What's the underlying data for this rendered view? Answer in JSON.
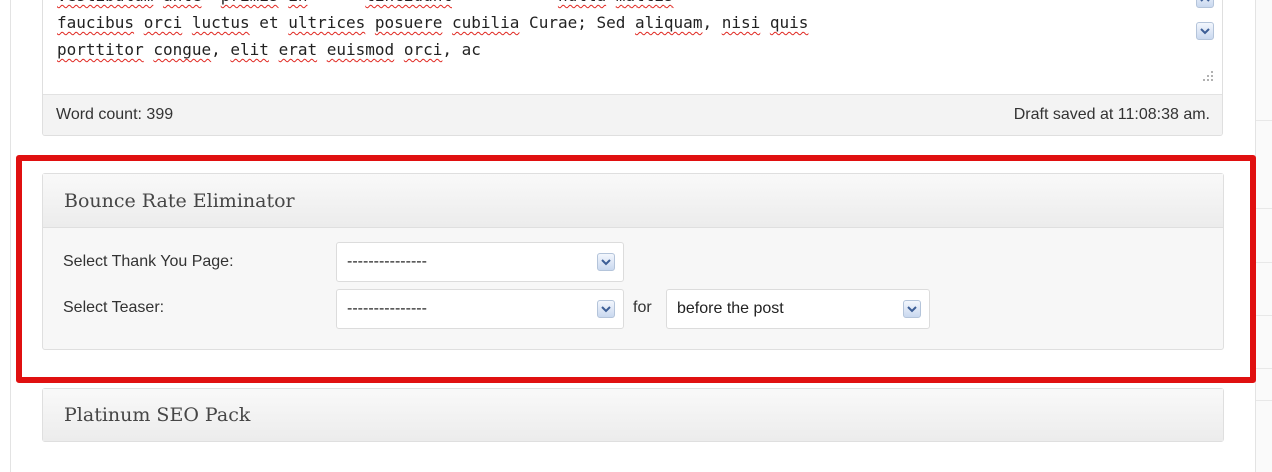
{
  "editor": {
    "lines": [
      [
        {
          "t": "faucibus",
          "s": true
        },
        {
          "t": " ",
          "s": false
        },
        {
          "t": "orci",
          "s": true
        },
        {
          "t": " ",
          "s": false
        },
        {
          "t": "luctus",
          "s": true
        },
        {
          "t": " et ",
          "s": false
        },
        {
          "t": "ultrices",
          "s": true
        },
        {
          "t": " ",
          "s": false
        },
        {
          "t": "posuere",
          "s": true
        },
        {
          "t": " ",
          "s": false
        },
        {
          "t": "cubilia",
          "s": true
        },
        {
          "t": " Curae; Sed ",
          "s": false
        },
        {
          "t": "aliquam",
          "s": true
        },
        {
          "t": ", ",
          "s": false
        },
        {
          "t": "nisi",
          "s": true
        },
        {
          "t": " ",
          "s": false
        },
        {
          "t": "quis",
          "s": true
        }
      ],
      [
        {
          "t": "porttitor",
          "s": true
        },
        {
          "t": " ",
          "s": false
        },
        {
          "t": "congue",
          "s": true
        },
        {
          "t": ", ",
          "s": false
        },
        {
          "t": "elit",
          "s": true
        },
        {
          "t": " ",
          "s": false
        },
        {
          "t": "erat",
          "s": true
        },
        {
          "t": " ",
          "s": false
        },
        {
          "t": "euismod",
          "s": true
        },
        {
          "t": " ",
          "s": false
        },
        {
          "t": "orci",
          "s": true
        },
        {
          "t": ", ac",
          "s": false
        }
      ]
    ],
    "word_count": "Word count: 399",
    "draft_saved": "Draft saved at 11:08:38 am."
  },
  "bounce_box": {
    "title": "Bounce Rate Eliminator",
    "thank_you_label": "Select Thank You Page:",
    "thank_you_value": "---------------",
    "teaser_label": "Select Teaser:",
    "teaser_value": "---------------",
    "for_label": "for",
    "position_value": "before the post"
  },
  "seo_box": {
    "title": "Platinum SEO Pack"
  },
  "colors": {
    "highlight": "#e01010",
    "spellcheck": "#e0261f"
  }
}
